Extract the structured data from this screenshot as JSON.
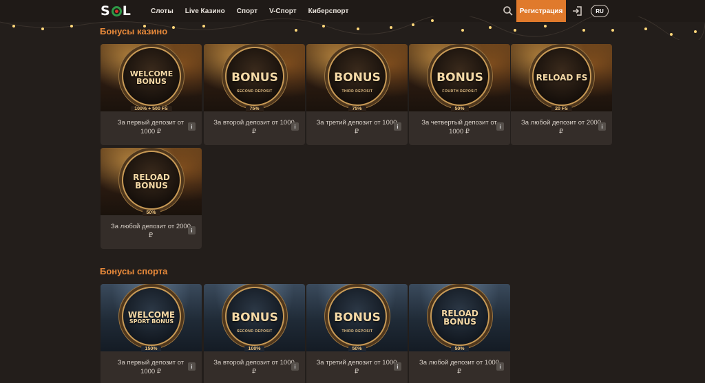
{
  "header": {
    "logo": "SOL",
    "nav": [
      "Слоты",
      "Live Казино",
      "Спорт",
      "V-Спорт",
      "Киберспорт"
    ],
    "register": "Регистрация",
    "lang": "RU"
  },
  "casino": {
    "title": "Бонусы казино",
    "cards": [
      {
        "t1": "WELCOME",
        "t2": "BONUS",
        "sub": "",
        "badge": "100% + 500 FS",
        "desc": "За первый депозит от 1000 ₽"
      },
      {
        "t1": "BONUS",
        "t2": "",
        "sub": "SECOND DEPOSIT",
        "badge": "75%",
        "desc": "За второй депозит от 1000 ₽"
      },
      {
        "t1": "BONUS",
        "t2": "",
        "sub": "THIRD DEPOSIT",
        "badge": "75%",
        "desc": "За третий депозит от 1000 ₽"
      },
      {
        "t1": "BONUS",
        "t2": "",
        "sub": "FOURTH DEPOSIT",
        "badge": "50%",
        "desc": "За четвертый депозит от 1000 ₽"
      },
      {
        "t1": "RELOAD FS",
        "t2": "",
        "sub": "",
        "badge": "20 FS",
        "desc": "За любой депозит от 2000 ₽"
      },
      {
        "t1": "RELOAD",
        "t2": "BONUS",
        "sub": "",
        "badge": "50%",
        "desc": "За любой депозит от 2000 ₽"
      }
    ]
  },
  "sport": {
    "title": "Бонусы спорта",
    "cards": [
      {
        "t1": "WELCOME",
        "t2": "SPORT BONUS",
        "sub": "",
        "badge": "150%",
        "desc": "За первый депозит от 1000 ₽"
      },
      {
        "t1": "BONUS",
        "t2": "",
        "sub": "SECOND DEPOSIT",
        "badge": "100%",
        "desc": "За второй депозит от 1000 ₽"
      },
      {
        "t1": "BONUS",
        "t2": "",
        "sub": "THIRD DEPOSIT",
        "badge": "50%",
        "desc": "За третий депозит от 1000 ₽"
      },
      {
        "t1": "RELOAD",
        "t2": "BONUS",
        "sub": "",
        "badge": "50%",
        "desc": "За любой депозит от 1000 ₽"
      }
    ]
  },
  "info_label": "i",
  "colors": {
    "accent": "#e07a2c",
    "title": "#e98a3a",
    "background": "#231e1b",
    "card": "#342d29"
  }
}
